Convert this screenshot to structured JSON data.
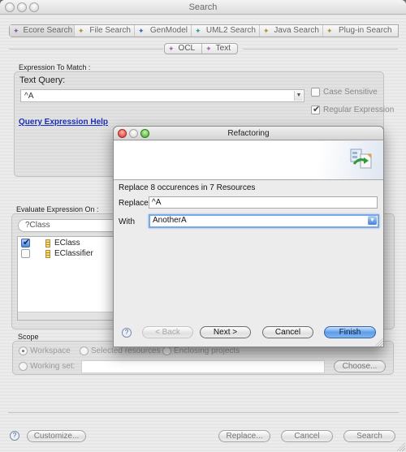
{
  "window": {
    "title": "Search"
  },
  "search_tabs": [
    {
      "label": "Ecore Search",
      "icon": "ecore-search-icon",
      "selected": true
    },
    {
      "label": "File Search",
      "icon": "file-search-icon",
      "selected": false
    },
    {
      "label": "GenModel",
      "icon": "genmodel-icon",
      "selected": false
    },
    {
      "label": "UML2 Search",
      "icon": "uml2-search-icon",
      "selected": false
    },
    {
      "label": "Java Search",
      "icon": "java-search-icon",
      "selected": false
    },
    {
      "label": "Plug-in Search",
      "icon": "plugin-search-icon",
      "selected": false
    }
  ],
  "query_tabs": [
    {
      "label": "OCL",
      "icon": "ocl-icon"
    },
    {
      "label": "Text",
      "icon": "text-icon"
    }
  ],
  "expression": {
    "group_label": "Expression To Match :",
    "text_query_label": "Text Query:",
    "text_query_value": "^A",
    "case_sensitive_label": "Case Sensitive",
    "case_sensitive_checked": false,
    "regex_label": "Regular Expression",
    "regex_checked": true,
    "help_link": "Query Expression Help"
  },
  "evaluate": {
    "group_label": "Evaluate Expression On :",
    "filter_value": "?Class",
    "items": [
      {
        "label": "EClass",
        "checked": true
      },
      {
        "label": "EClassifier",
        "checked": false
      }
    ]
  },
  "scope": {
    "group_label": "Scope",
    "workspace_label": "Workspace",
    "selected_resources_label": "Selected resources",
    "enclosing_projects_label": "Enclosing projects",
    "working_set_label": "Working set:",
    "working_set_value": "",
    "choose_button": "Choose...",
    "selected": "Workspace"
  },
  "footer": {
    "customize_button": "Customize...",
    "replace_button": "Replace...",
    "cancel_button": "Cancel",
    "search_button": "Search"
  },
  "refactoring_dialog": {
    "title": "Refactoring",
    "summary": "Replace 8 occurences in 7 Resources",
    "replace_label": "Replace",
    "replace_value": "^A",
    "with_label": "With",
    "with_value": "AnotherA",
    "back_button": "< Back",
    "next_button": "Next >",
    "cancel_button": "Cancel",
    "finish_button": "Finish"
  },
  "icons": {
    "help": "?",
    "dropdown": "▼"
  }
}
